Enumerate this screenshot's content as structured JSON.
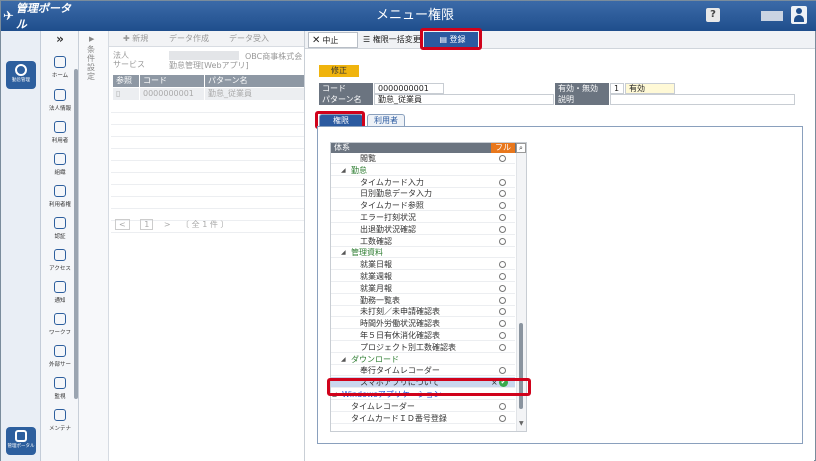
{
  "header": {
    "logo": "管理ポータル",
    "title": "メニュー権限",
    "help": "?"
  },
  "rail": {
    "apps": [
      {
        "label": "勤怠管理"
      },
      {
        "label": "管理ポータル"
      }
    ]
  },
  "nav": {
    "chevron": "»",
    "items": [
      {
        "label": "ホーム"
      },
      {
        "label": "法人情報"
      },
      {
        "label": "利用者"
      },
      {
        "label": "組織"
      },
      {
        "label": "利用者権"
      },
      {
        "label": "認証"
      },
      {
        "label": "アクセス"
      },
      {
        "label": "通知"
      },
      {
        "label": "ワークフ"
      },
      {
        "label": "外部サー"
      },
      {
        "label": "監視"
      },
      {
        "label": "メンテナ"
      }
    ]
  },
  "filter": {
    "label": "条件設定"
  },
  "list": {
    "toolbar": {
      "new": "✚ 新規",
      "create_data": "データ作成",
      "import_data": "データ受入"
    },
    "conditions": {
      "corp": "法人",
      "service": "サービス",
      "service_value": "勤怠管理[Webアプリ]",
      "corp_value": "OBC商事株式会"
    },
    "columns": [
      "参照",
      "コード",
      "パターン名"
    ],
    "rows": [
      {
        "code": "0000000001",
        "name": "勤怠_従業員"
      }
    ],
    "pager": {
      "page": "1",
      "total": "〔 全 1 件 〕"
    }
  },
  "modal": {
    "toolbar": {
      "stop": "中止",
      "bulk": "権限一括変更",
      "register": "登録"
    },
    "mode_badge": "修正",
    "fields": {
      "code_label": "コード",
      "code_value": "0000000001",
      "pattern_label": "パターン名",
      "pattern_value": "勤怠_従業員",
      "valid_label": "有効・無効",
      "valid_num": "1",
      "valid_value": "有効",
      "desc_label": "説明",
      "desc_value": ""
    },
    "tabs": [
      "権限",
      "利用者"
    ],
    "tree": {
      "header": {
        "col1": "体系",
        "col2": "フル",
        "search": "🔍"
      },
      "rows": [
        {
          "label": "閲覧",
          "kind": "item",
          "indent": 2
        },
        {
          "label": "勤怠",
          "kind": "group",
          "indent": 1
        },
        {
          "label": "タイムカード入力",
          "kind": "item",
          "indent": 2
        },
        {
          "label": "日別勤怠データ入力",
          "kind": "item",
          "indent": 2
        },
        {
          "label": "タイムカード参照",
          "kind": "item",
          "indent": 2
        },
        {
          "label": "エラー打刻状況",
          "kind": "item",
          "indent": 2
        },
        {
          "label": "出退勤状況確認",
          "kind": "item",
          "indent": 2
        },
        {
          "label": "工数確認",
          "kind": "item",
          "indent": 2
        },
        {
          "label": "管理資料",
          "kind": "group",
          "indent": 1
        },
        {
          "label": "就業日報",
          "kind": "item",
          "indent": 2
        },
        {
          "label": "就業週報",
          "kind": "item",
          "indent": 2
        },
        {
          "label": "就業月報",
          "kind": "item",
          "indent": 2
        },
        {
          "label": "勤務一覧表",
          "kind": "item",
          "indent": 2
        },
        {
          "label": "未打刻／未申請確認表",
          "kind": "item",
          "indent": 2
        },
        {
          "label": "時間外労働状況確認表",
          "kind": "item",
          "indent": 2
        },
        {
          "label": "年５日有休消化確認表",
          "kind": "item",
          "indent": 2
        },
        {
          "label": "プロジェクト別工数確認表",
          "kind": "item",
          "indent": 2
        },
        {
          "label": "ダウンロード",
          "kind": "group",
          "indent": 1
        },
        {
          "label": "奉行タイムレコーダー",
          "kind": "item",
          "indent": 2
        },
        {
          "label": "スマホアプリについて",
          "kind": "selected",
          "indent": 2
        },
        {
          "label": "Windowsアプリケーション",
          "kind": "group2",
          "indent": 0
        },
        {
          "label": "タイムレコーダー",
          "kind": "item",
          "indent": 1
        },
        {
          "label": "タイムカードＩＤ番号登録",
          "kind": "item",
          "indent": 1
        }
      ],
      "selected_x": "×",
      "selected_check": "✔"
    }
  },
  "colors": {
    "header": "#1f4e8c",
    "register": "#2b5aa0",
    "highlight": "#d0021b",
    "group": "#2e7d32",
    "group2": "#1d4fd6",
    "full_col": "#e8771c"
  }
}
